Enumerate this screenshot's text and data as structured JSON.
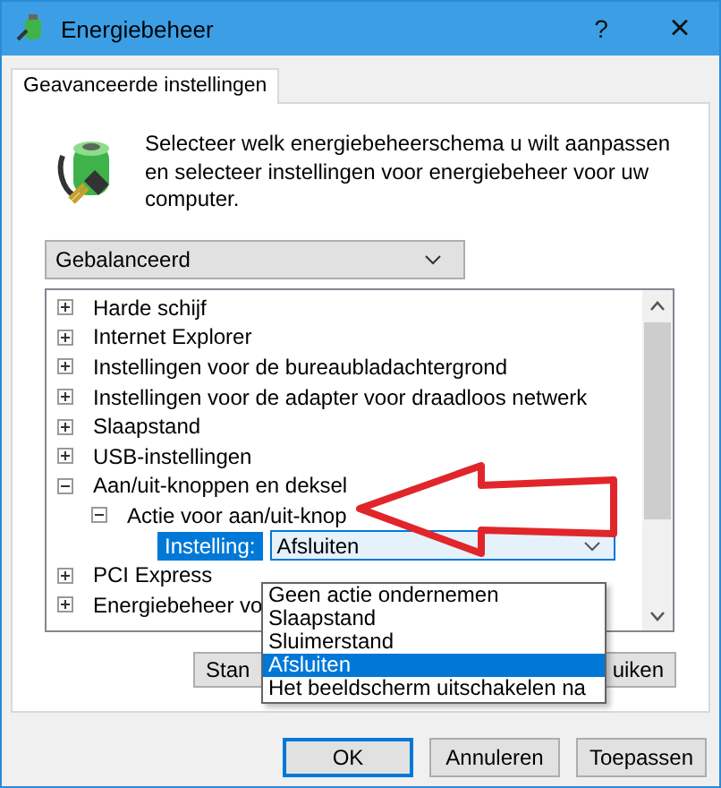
{
  "window": {
    "title": "Energiebeheer"
  },
  "title_buttons": [
    {
      "kind": "help",
      "label": "?"
    },
    {
      "kind": "close",
      "label": "×"
    }
  ],
  "tabs": [
    {
      "label": "Geavanceerde instellingen",
      "selected": true
    }
  ],
  "description": "Selecteer welk energiebeheerschema u wilt aanpassen en selecteer instellingen voor energiebeheer voor uw computer.",
  "plan_select": {
    "value": "Gebalanceerd"
  },
  "tree": {
    "items": [
      {
        "label": "Harde schijf",
        "expanded": false
      },
      {
        "label": "Internet Explorer",
        "expanded": false
      },
      {
        "label": "Instellingen voor de bureaubladachtergrond",
        "expanded": false
      },
      {
        "label": "Instellingen voor de adapter voor draadloos netwerk",
        "expanded": false
      },
      {
        "label": "Slaapstand",
        "expanded": false
      },
      {
        "label": "USB-instellingen",
        "expanded": false
      },
      {
        "label": "Aan/uit-knoppen en deksel",
        "expanded": true,
        "children": [
          {
            "label": "Actie voor aan/uit-knop",
            "expanded": true,
            "setting": {
              "label": "Instelling:",
              "value": "Afsluiten",
              "options": [
                {
                  "label": "Geen actie ondernemen",
                  "selected": false
                },
                {
                  "label": "Slaapstand",
                  "selected": false
                },
                {
                  "label": "Sluimerstand",
                  "selected": false
                },
                {
                  "label": "Afsluiten",
                  "selected": true
                },
                {
                  "label": "Het beeldscherm uitschakelen na",
                  "selected": false
                }
              ]
            }
          }
        ]
      },
      {
        "label": "PCI Express",
        "expanded": false
      },
      {
        "label": "Energiebeheer vo",
        "expanded": false
      }
    ]
  },
  "panel_buttons": [
    "Stan",
    "uiken"
  ],
  "buttons": [
    {
      "label": "OK",
      "default": true
    },
    {
      "label": "Annuleren",
      "default": false
    },
    {
      "label": "Toepassen",
      "default": false
    }
  ]
}
